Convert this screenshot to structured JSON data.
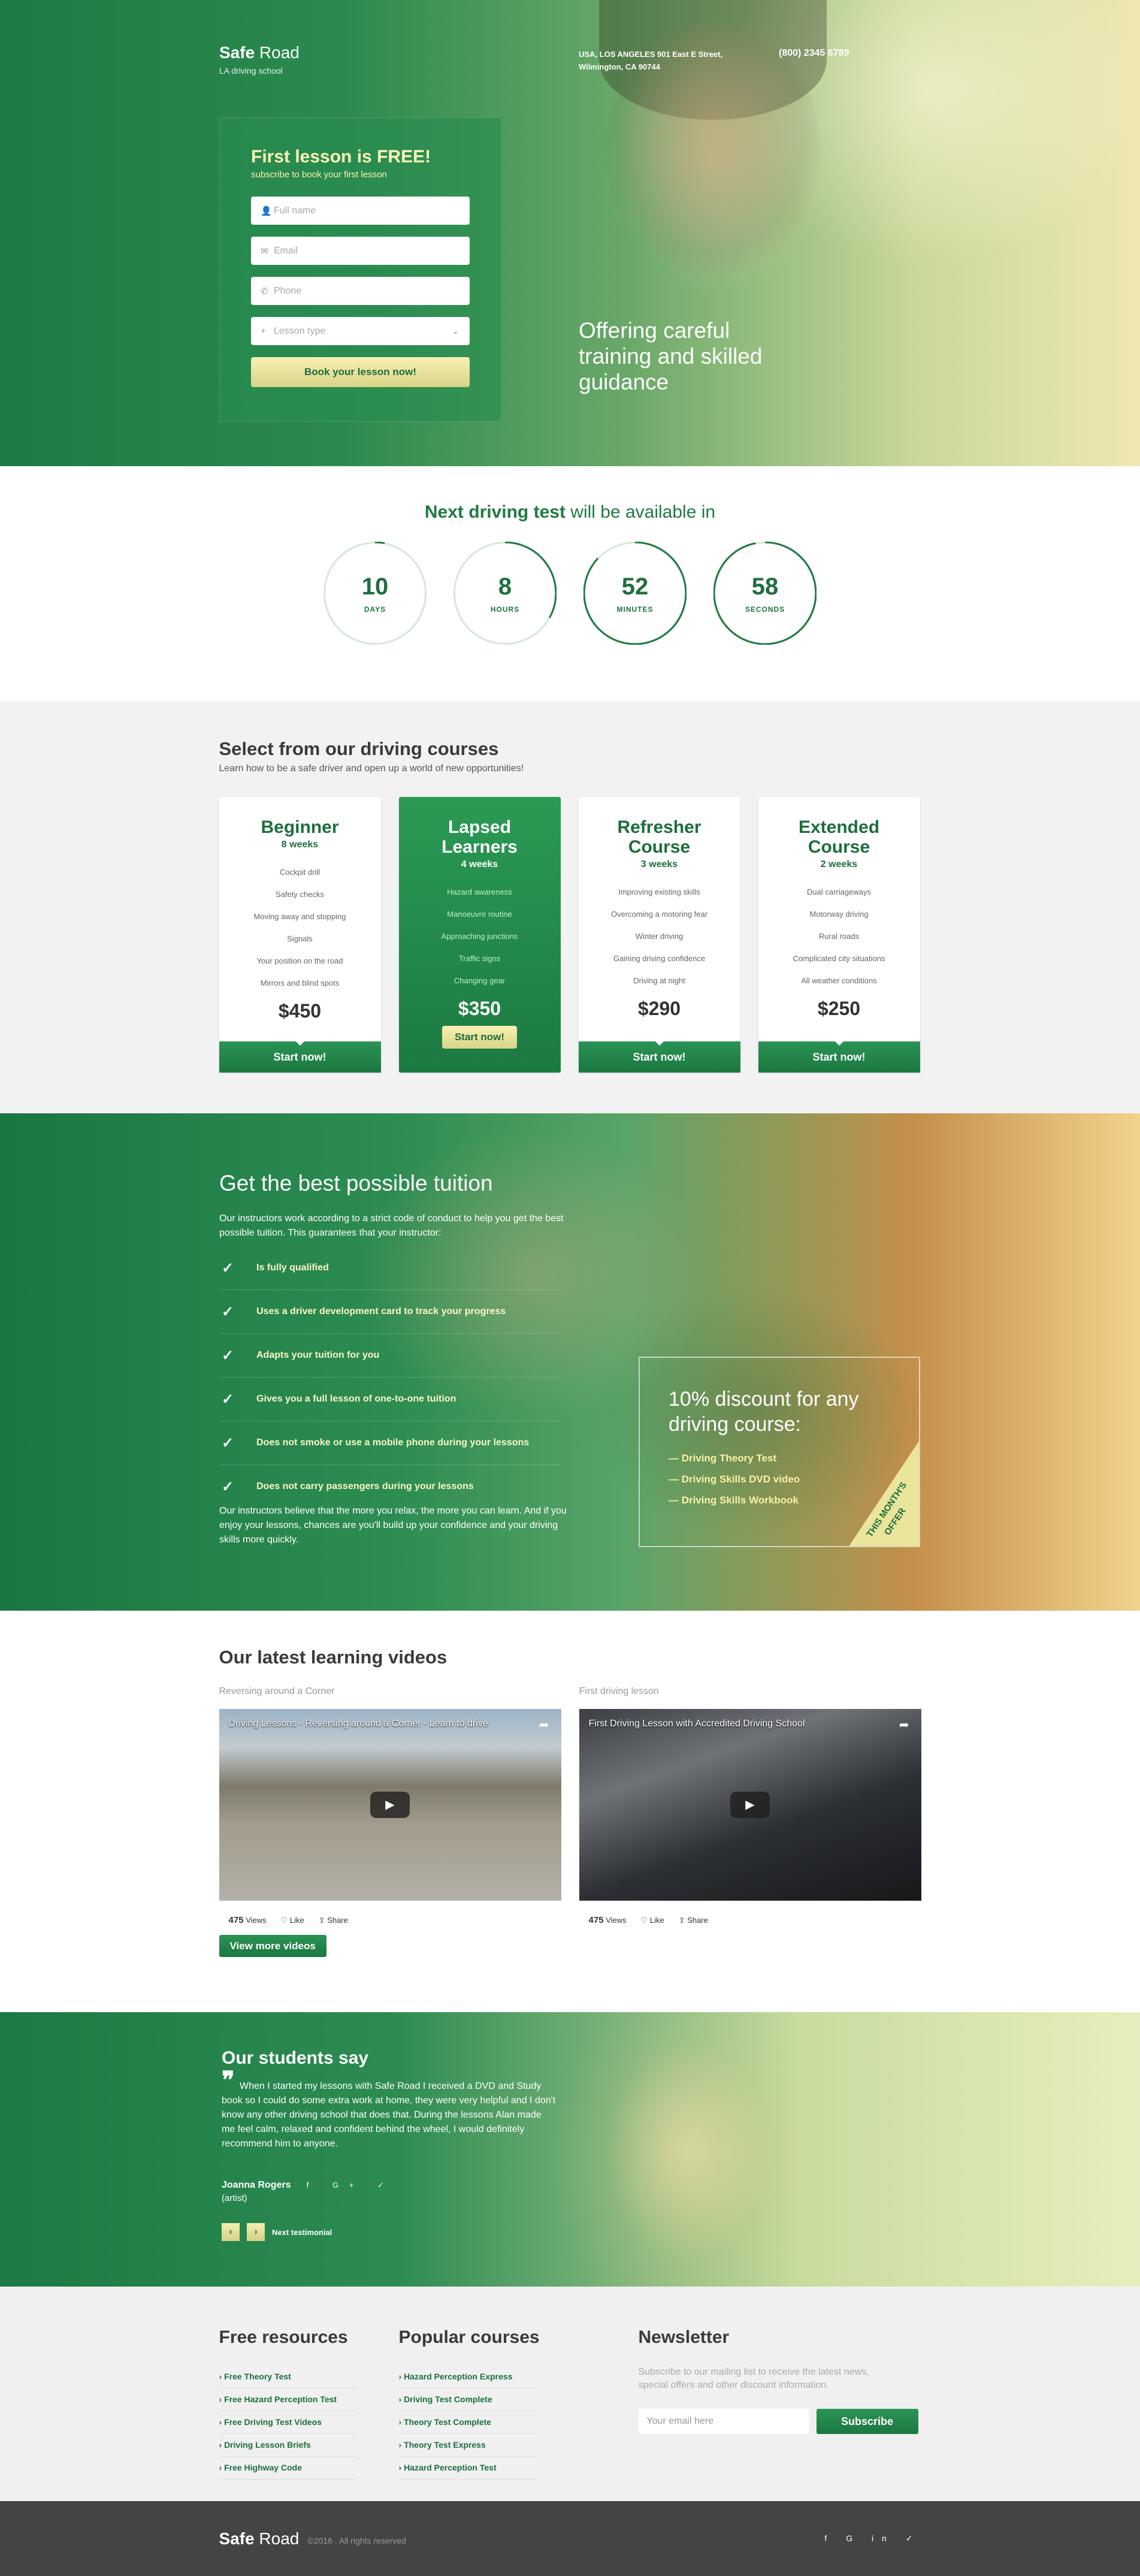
{
  "header": {
    "logo_bold": "Safe",
    "logo_rest": " Road",
    "tagline": "LA driving school",
    "address_line1": "USA, LOS ANGELES 901 East E Street,",
    "address_line2": "Wilmington, CA 90744",
    "phone": "(800) 2345 6789"
  },
  "hero": {
    "form_title": "First lesson is FREE!",
    "form_subtitle": "subscribe to book your first lesson",
    "name_placeholder": "Full name",
    "email_placeholder": "Email",
    "phone_placeholder": "Phone",
    "lesson_placeholder": "Lesson type",
    "book_button": "Book your lesson now!",
    "text_line1": "Offering careful",
    "text_line2": "training and skilled",
    "text_line3": "guidance"
  },
  "countdown": {
    "title_bold": "Next driving test",
    "title_rest": " will be available in",
    "items": [
      {
        "value": "10",
        "label": "DAYS",
        "progress": 0.03
      },
      {
        "value": "8",
        "label": "HOURS",
        "progress": 0.33
      },
      {
        "value": "52",
        "label": "MINUTES",
        "progress": 0.87
      },
      {
        "value": "58",
        "label": "SECONDS",
        "progress": 0.97
      }
    ]
  },
  "courses": {
    "title": "Select from our driving courses",
    "lead": "Learn how to be a safe driver and open up a world of new opportunities!",
    "cards": [
      {
        "title1": "Beginner",
        "title2": "",
        "weeks": "8 weeks",
        "items": [
          "Cockpit drill",
          "Safety checks",
          "Moving away and stopping",
          "Signals",
          "Your position on the road",
          "Mirrors and blind spots"
        ],
        "price": "$450",
        "button": "Start now!"
      },
      {
        "title1": "Lapsed",
        "title2": "Learners",
        "weeks": "4 weeks",
        "items": [
          "Hazard awareness",
          "Manoeuvre routine",
          "Approaching junctions",
          "Traffic signs",
          "Changing gear"
        ],
        "price": "$350",
        "button": "Start now!"
      },
      {
        "title1": "Refresher",
        "title2": "Course",
        "weeks": "3 weeks",
        "items": [
          "Improving existing skills",
          "Overcoming a motoring fear",
          "Winter driving",
          "Gaining driving confidence",
          "Driving at night"
        ],
        "price": "$290",
        "button": "Start now!"
      },
      {
        "title1": "Extended",
        "title2": "Course",
        "weeks": "2 weeks",
        "items": [
          "Dual carriageways",
          "Motorway driving",
          "Rural roads",
          "Complicated city situations",
          "All weather conditions"
        ],
        "price": "$250",
        "button": "Start now!"
      }
    ]
  },
  "tuition": {
    "title": "Get the best possible tuition",
    "intro": "Our instructors work according to a strict code of conduct to help you get the best possible tuition. This guarantees that your instructor:",
    "checks": [
      "Is fully qualified",
      "Uses a driver development card to track your progress",
      "Adapts your tuition for you",
      "Gives you a full lesson of one-to-one tuition",
      "Does not smoke or use a mobile phone during your lessons",
      "Does not carry passengers during your lessons"
    ],
    "outro": "Our instructors believe that the more you relax, the more you can learn. And if you enjoy your lessons, chances are you'll build up your confidence and your driving skills more quickly.",
    "discount_title": "10% discount for any driving course:",
    "discount_items": [
      "— Driving Theory Test",
      "— Driving Skills DVD video",
      "— Driving Skills Workbook"
    ],
    "ribbon_line1": "THIS MONTH'S",
    "ribbon_line2": "OFFER"
  },
  "videos": {
    "title": "Our latest learning videos",
    "items": [
      {
        "caption": "Reversing around a Corner",
        "title": "Driving Lessons - Reversing around a Corner - Learn to drive",
        "views": "475",
        "views_label": "Views",
        "like": "Like",
        "share": "Share"
      },
      {
        "caption": "First driving lesson",
        "title": "First Driving Lesson with Accredited Driving School",
        "views": "475",
        "views_label": "Views",
        "like": "Like",
        "share": "Share"
      }
    ],
    "more_button": "View more videos"
  },
  "testimonial": {
    "title": "Our students say",
    "quote": "When I started my lessons with Safe Road I received a DVD and Study book so I could do some extra work at home, they were very helpful and I don't know any other driving school that does that. During the lessons Alan made me feel calm, relaxed and confident behind the wheel, I would definitely recommend him to anyone.",
    "author": "Joanna Rogers",
    "role": "(artist)",
    "social": "f G+ ✓",
    "next": "Next testimonial"
  },
  "footer": {
    "resources_title": "Free resources",
    "resources": [
      "Free Theory Test",
      "Free Hazard Perception Test",
      "Free Driving Test Videos",
      "Driving Lesson Briefs",
      "Free Highway Code"
    ],
    "popular_title": "Popular courses",
    "popular": [
      "Hazard Perception Express",
      "Driving Test Complete",
      "Theory Test Complete",
      "Theory Test Express",
      "Hazard Perception Test"
    ],
    "newsletter_title": "Newsletter",
    "newsletter_text": "Subscribe to our mailing list to receive the latest news, special offers and other discount information.",
    "email_placeholder": "Your email here",
    "subscribe": "Subscribe",
    "copyright": "©2016 . All rights reserved",
    "social": "f G in ✓"
  },
  "colors": {
    "brand_green": "#1f7a45",
    "accent_yellow": "#fdf6b5"
  }
}
